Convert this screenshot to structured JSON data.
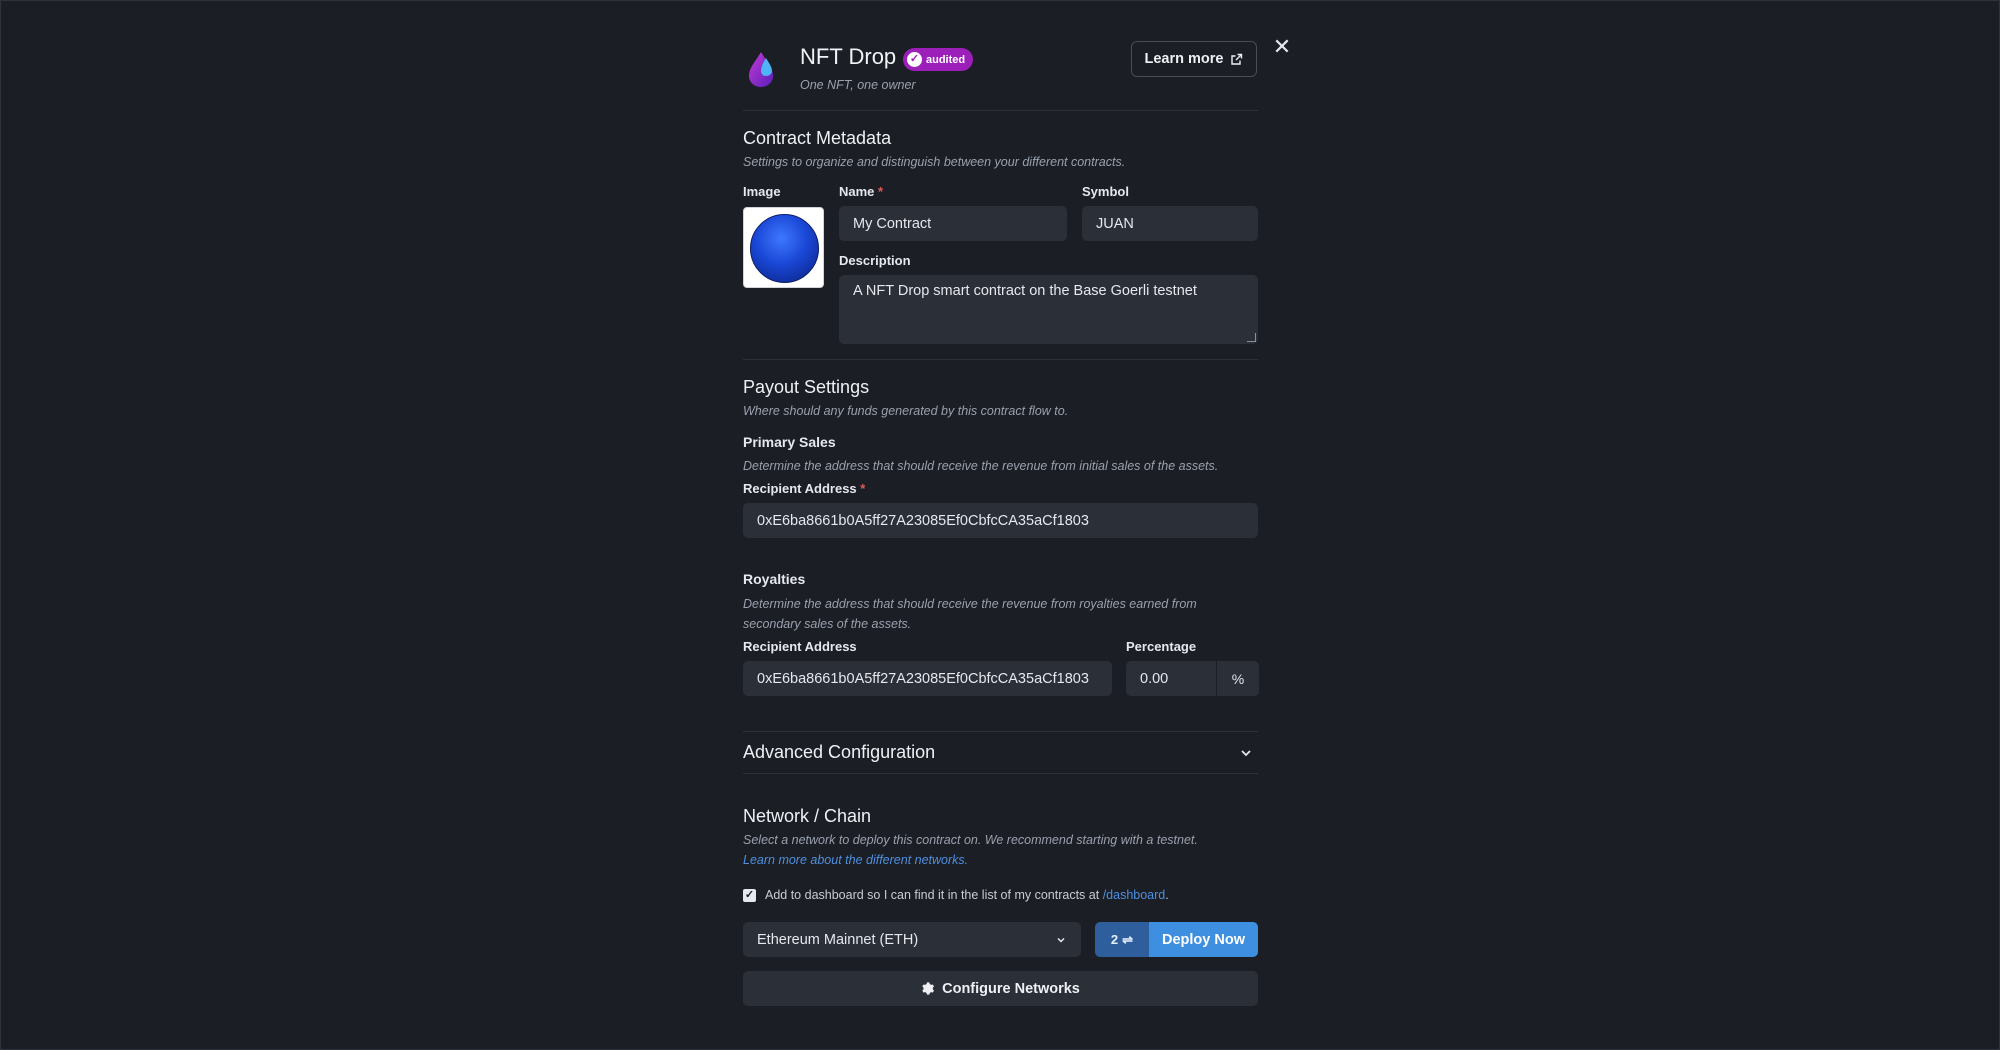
{
  "header": {
    "title": "NFT Drop",
    "badge": "audited",
    "subtitle": "One NFT, one owner",
    "learn_more": "Learn more"
  },
  "metadata": {
    "heading": "Contract Metadata",
    "description": "Settings to organize and distinguish between your different contracts.",
    "image_label": "Image",
    "name_label": "Name",
    "name_value": "My Contract",
    "symbol_label": "Symbol",
    "symbol_value": "JUAN",
    "desc_label": "Description",
    "desc_value": "A NFT Drop smart contract on the Base Goerli testnet"
  },
  "payout": {
    "heading": "Payout Settings",
    "description": "Where should any funds generated by this contract flow to.",
    "primary_heading": "Primary Sales",
    "primary_desc": "Determine the address that should receive the revenue from initial sales of the assets.",
    "primary_label": "Recipient Address",
    "primary_value": "0xE6ba8661b0A5ff27A23085Ef0CbfcCA35aCf1803",
    "royalties_heading": "Royalties",
    "royalties_desc_1": "Determine the address that should receive the revenue from royalties earned from",
    "royalties_desc_2": "secondary sales of the assets.",
    "royalties_label": "Recipient Address",
    "royalties_value": "0xE6ba8661b0A5ff27A23085Ef0CbfcCA35aCf1803",
    "percentage_label": "Percentage",
    "percentage_value": "0.00",
    "percentage_suffix": "%"
  },
  "advanced": {
    "heading": "Advanced Configuration"
  },
  "network": {
    "heading": "Network / Chain",
    "description": "Select a network to deploy this contract on. We recommend starting with a testnet.",
    "learn_link": "Learn more about the different networks.",
    "checkbox_text": "Add to dashboard so I can find it in the list of my contracts at",
    "checkbox_link": "/dashboard",
    "checkbox_period": ".",
    "select_value": "Ethereum Mainnet (ETH)",
    "deploy_count": "2",
    "deploy_label": "Deploy Now",
    "configure_label": "Configure Networks"
  },
  "colors": {
    "background": "#1b1e25",
    "badge": "#9b1fb8",
    "primary_button": "#3f8fe0",
    "link": "#4e8fe0"
  },
  "icons": {
    "logo": "nft-drop-logo-icon",
    "badge": "check-circle-icon",
    "learn_more": "external-link-icon",
    "close": "close-icon",
    "advanced": "chevron-down-icon",
    "select": "chevron-down-icon",
    "deploy": "swap-icon",
    "configure": "gear-icon"
  }
}
